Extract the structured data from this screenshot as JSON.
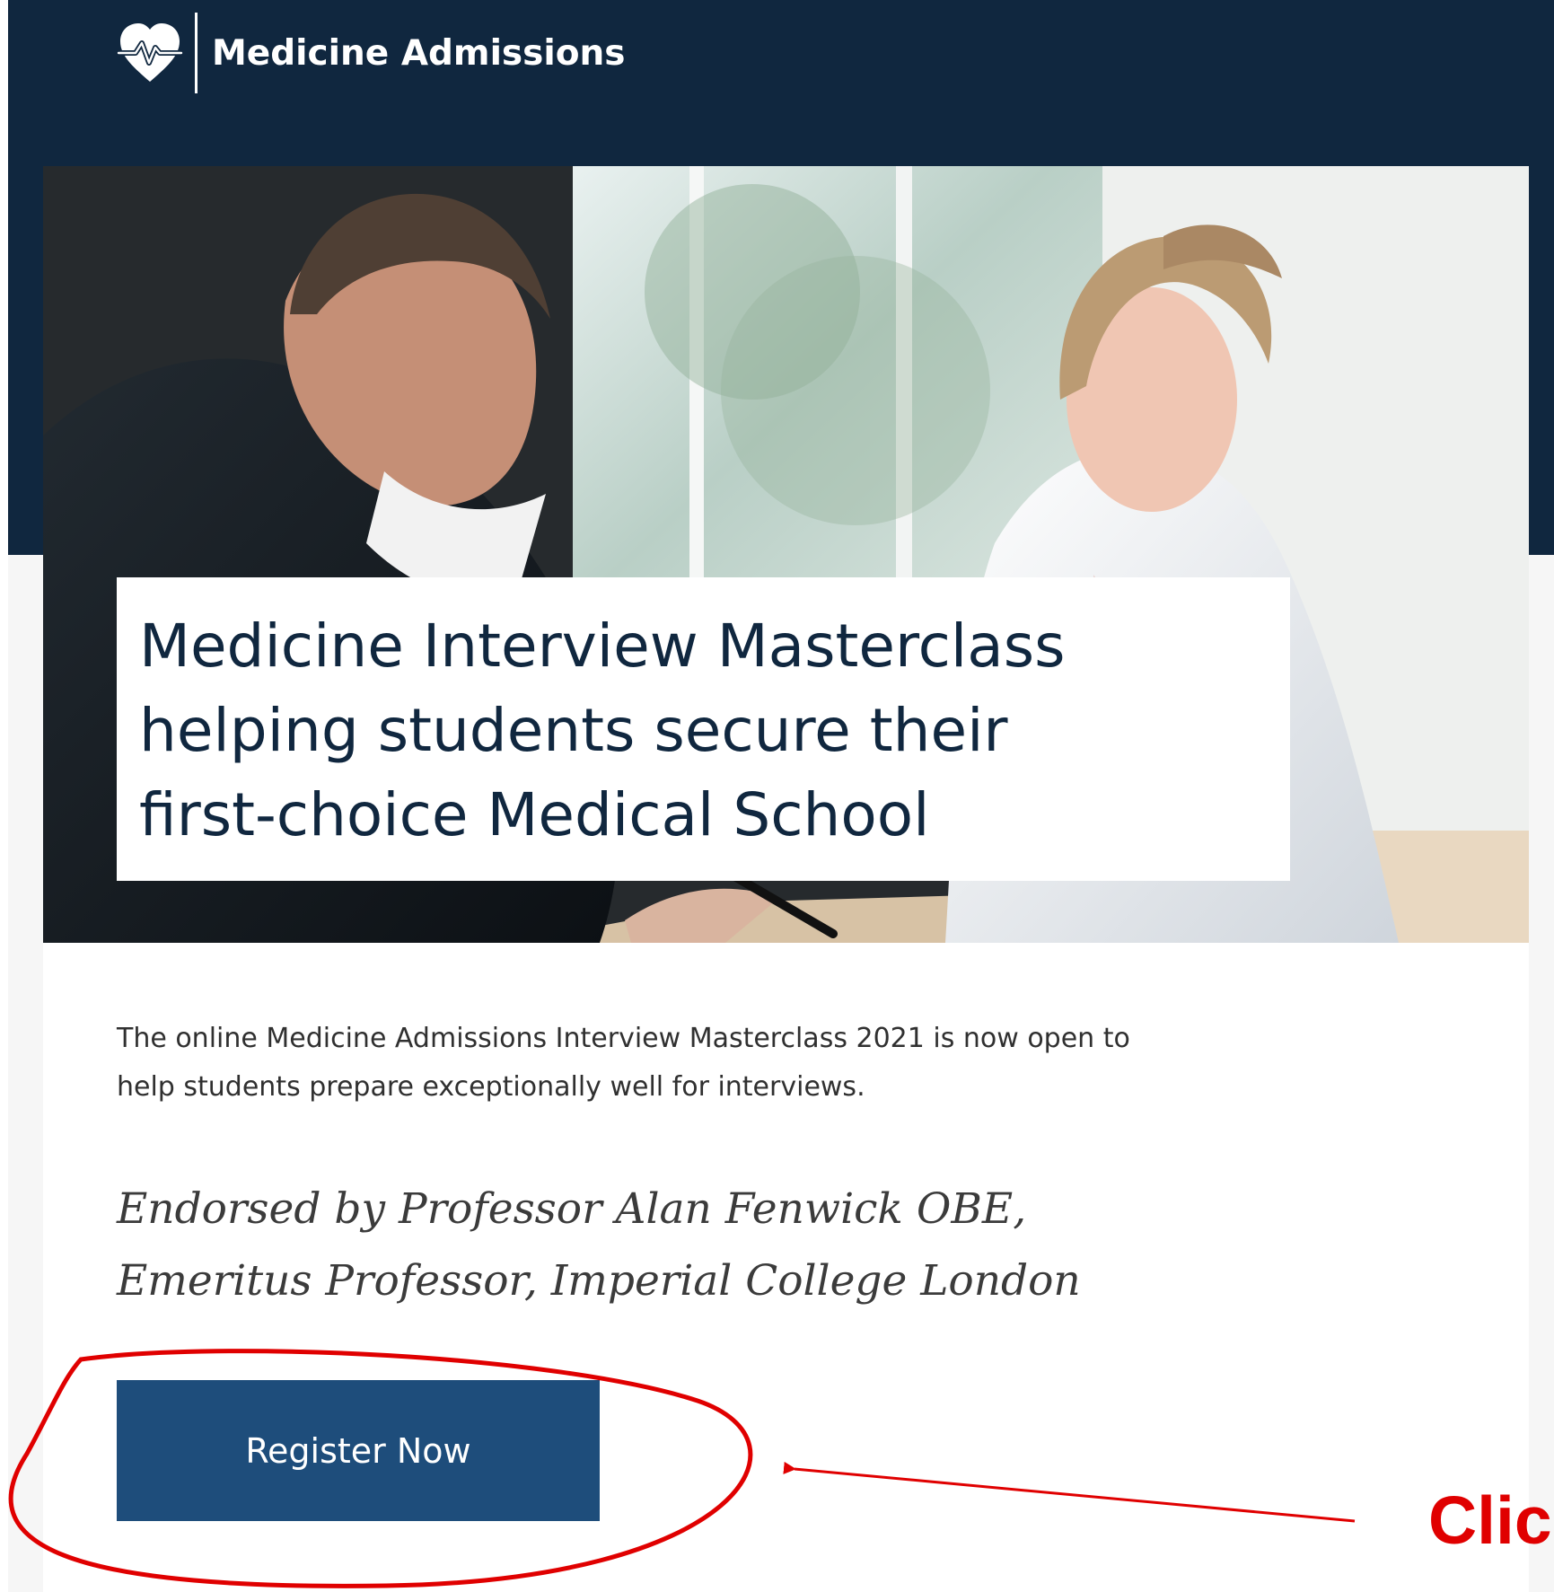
{
  "header": {
    "brand_name": "Medicine Admissions",
    "logo_icon": "heart-pulse-icon",
    "background_color": "#10273f"
  },
  "hero": {
    "image_description_icon": "interview-photo",
    "headline_lines": [
      "Medicine Interview Masterclass",
      "helping students secure their",
      "first-choice Medical School"
    ]
  },
  "content": {
    "intro_lines": [
      "The online Medicine Admissions Interview Masterclass 2021 is now open to",
      "help students prepare exceptionally well for interviews."
    ],
    "endorsement_lines": [
      "Endorsed by Professor Alan Fenwick OBE,",
      "Emeritus Professor, Imperial College London"
    ]
  },
  "cta": {
    "register_label": "Register Now",
    "button_color": "#1e4d7b"
  },
  "annotation": {
    "label": "Clic",
    "color": "#e00000"
  }
}
